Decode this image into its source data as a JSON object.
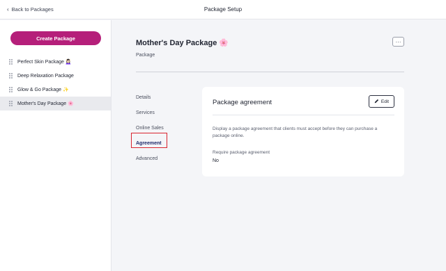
{
  "header": {
    "back_label": "Back to Packages",
    "title": "Package Setup"
  },
  "sidebar": {
    "create_label": "Create Package",
    "items": [
      {
        "label": "Perfect Skin Package 💆🏻‍♀️"
      },
      {
        "label": "Deep Relaxation Package"
      },
      {
        "label": "Glow & Go Package ✨"
      },
      {
        "label": "Mother's Day Package 🌸"
      }
    ]
  },
  "main": {
    "title": "Mother's Day Package 🌸",
    "subtitle": "Package",
    "more_label": "···",
    "tabs": [
      {
        "label": "Details"
      },
      {
        "label": "Services"
      },
      {
        "label": "Online Sales"
      },
      {
        "label": "Agreement"
      },
      {
        "label": "Advanced"
      }
    ],
    "card": {
      "title": "Package agreement",
      "edit_label": "Edit",
      "description": "Display a package agreement that clients must accept before they can purchase a package online.",
      "require_label": "Require package agreement",
      "require_value": "No"
    }
  },
  "colors": {
    "accent": "#b51f7a",
    "active_tab": "#1f2a6b",
    "highlight": "#d9232e"
  }
}
